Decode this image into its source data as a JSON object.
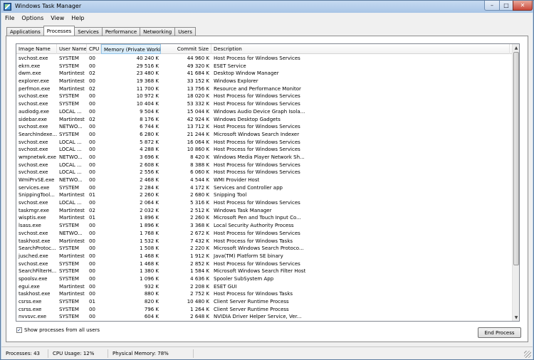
{
  "window": {
    "title": "Windows Task Manager"
  },
  "menu": [
    "File",
    "Options",
    "View",
    "Help"
  ],
  "tabs": [
    "Applications",
    "Processes",
    "Services",
    "Performance",
    "Networking",
    "Users"
  ],
  "active_tab": "Processes",
  "columns": [
    "Image Name",
    "User Name",
    "CPU",
    "Memory (Private Worki...",
    "Commit Size",
    "Description"
  ],
  "rows": [
    [
      "svchost.exe",
      "SYSTEM",
      "00",
      "40 240 K",
      "44 960 K",
      "Host Process for Windows Services"
    ],
    [
      "ekrn.exe",
      "SYSTEM",
      "00",
      "29 516 K",
      "49 320 K",
      "ESET Service"
    ],
    [
      "dwm.exe",
      "Martintest",
      "02",
      "23 480 K",
      "41 684 K",
      "Desktop Window Manager"
    ],
    [
      "explorer.exe",
      "Martintest",
      "00",
      "19 368 K",
      "33 152 K",
      "Windows Explorer"
    ],
    [
      "perfmon.exe",
      "Martintest",
      "02",
      "11 700 K",
      "13 756 K",
      "Resource and Performance Monitor"
    ],
    [
      "svchost.exe",
      "SYSTEM",
      "00",
      "10 972 K",
      "18 020 K",
      "Host Process for Windows Services"
    ],
    [
      "svchost.exe",
      "SYSTEM",
      "00",
      "10 404 K",
      "53 332 K",
      "Host Process for Windows Services"
    ],
    [
      "audiodg.exe",
      "LOCAL ...",
      "00",
      "9 504 K",
      "15 044 K",
      "Windows Audio Device Graph Isola..."
    ],
    [
      "sidebar.exe",
      "Martintest",
      "02",
      "8 176 K",
      "42 924 K",
      "Windows Desktop Gadgets"
    ],
    [
      "svchost.exe",
      "NETWO...",
      "00",
      "6 744 K",
      "13 712 K",
      "Host Process for Windows Services"
    ],
    [
      "SearchIndexe...",
      "SYSTEM",
      "00",
      "6 280 K",
      "21 244 K",
      "Microsoft Windows Search Indexer"
    ],
    [
      "svchost.exe",
      "LOCAL ...",
      "00",
      "5 872 K",
      "16 064 K",
      "Host Process for Windows Services"
    ],
    [
      "svchost.exe",
      "LOCAL ...",
      "00",
      "4 288 K",
      "10 860 K",
      "Host Process for Windows Services"
    ],
    [
      "wmpnetwk.exe",
      "NETWO...",
      "00",
      "3 696 K",
      "8 420 K",
      "Windows Media Player Network Sh..."
    ],
    [
      "svchost.exe",
      "LOCAL ...",
      "00",
      "2 608 K",
      "8 388 K",
      "Host Process for Windows Services"
    ],
    [
      "svchost.exe",
      "LOCAL ...",
      "00",
      "2 556 K",
      "6 060 K",
      "Host Process for Windows Services"
    ],
    [
      "WmiPrvSE.exe",
      "NETWO...",
      "00",
      "2 468 K",
      "4 544 K",
      "WMI Provider Host"
    ],
    [
      "services.exe",
      "SYSTEM",
      "00",
      "2 284 K",
      "4 172 K",
      "Services and Controller app"
    ],
    [
      "SnippingTool...",
      "Martintest",
      "01",
      "2 260 K",
      "2 680 K",
      "Snipping Tool"
    ],
    [
      "svchost.exe",
      "LOCAL ...",
      "00",
      "2 064 K",
      "5 316 K",
      "Host Process for Windows Services"
    ],
    [
      "taskmgr.exe",
      "Martintest",
      "02",
      "2 032 K",
      "2 512 K",
      "Windows Task Manager"
    ],
    [
      "wisptis.exe",
      "Martintest",
      "01",
      "1 896 K",
      "2 260 K",
      "Microsoft Pen and Touch Input Co..."
    ],
    [
      "lsass.exe",
      "SYSTEM",
      "00",
      "1 896 K",
      "3 368 K",
      "Local Security Authority Process"
    ],
    [
      "svchost.exe",
      "NETWO...",
      "00",
      "1 768 K",
      "2 672 K",
      "Host Process for Windows Services"
    ],
    [
      "taskhost.exe",
      "Martintest",
      "00",
      "1 532 K",
      "7 432 K",
      "Host Process for Windows Tasks"
    ],
    [
      "SearchProtoc...",
      "SYSTEM",
      "00",
      "1 508 K",
      "2 220 K",
      "Microsoft Windows Search Protoco..."
    ],
    [
      "jusched.exe",
      "Martintest",
      "00",
      "1 468 K",
      "1 912 K",
      "Java(TM) Platform SE binary"
    ],
    [
      "svchost.exe",
      "SYSTEM",
      "00",
      "1 468 K",
      "2 852 K",
      "Host Process for Windows Services"
    ],
    [
      "SearchFilterH...",
      "SYSTEM",
      "00",
      "1 380 K",
      "1 584 K",
      "Microsoft Windows Search Filter Host"
    ],
    [
      "spoolsv.exe",
      "SYSTEM",
      "00",
      "1 096 K",
      "4 636 K",
      "Spooler SubSystem App"
    ],
    [
      "egui.exe",
      "Martintest",
      "00",
      "932 K",
      "2 208 K",
      "ESET GUI"
    ],
    [
      "taskhost.exe",
      "Martintest",
      "00",
      "880 K",
      "2 752 K",
      "Host Process for Windows Tasks"
    ],
    [
      "csrss.exe",
      "SYSTEM",
      "01",
      "820 K",
      "10 480 K",
      "Client Server Runtime Process"
    ],
    [
      "csrss.exe",
      "SYSTEM",
      "00",
      "796 K",
      "1 264 K",
      "Client Server Runtime Process"
    ],
    [
      "nvvsvc.exe",
      "SYSTEM",
      "00",
      "604 K",
      "2 648 K",
      "NVIDIA Driver Helper Service, Ver..."
    ]
  ],
  "show_all_label": "Show processes from all users",
  "show_all_checked": "✓",
  "end_process_label": "End Process",
  "status": {
    "processes": "Processes: 43",
    "cpu": "CPU Usage: 12%",
    "memory": "Physical Memory: 78%"
  }
}
